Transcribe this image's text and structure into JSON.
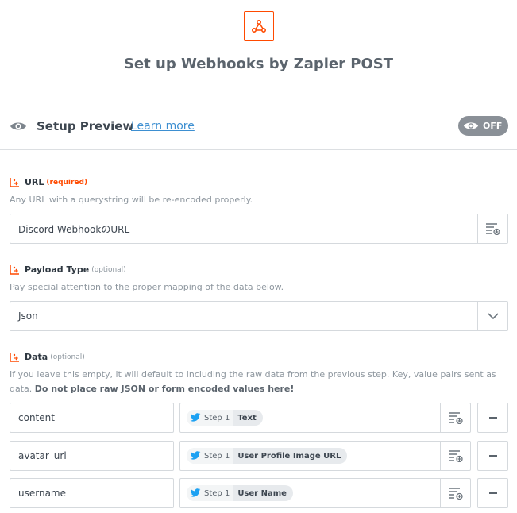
{
  "header": {
    "title": "Set up Webhooks by Zapier POST",
    "app_icon": "webhook-icon"
  },
  "preview": {
    "label": "Setup Preview",
    "learn_more": "Learn more",
    "toggle": "OFF"
  },
  "url_field": {
    "label": "URL",
    "required_tag": "(required)",
    "help": "Any URL with a querystring will be re-encoded properly.",
    "value": "Discord WebhookのURL"
  },
  "payload_field": {
    "label": "Payload Type",
    "optional_tag": "(optional)",
    "help": "Pay special attention to the proper mapping of the data below.",
    "value": "Json"
  },
  "data_field": {
    "label": "Data",
    "optional_tag": "(optional)",
    "help": "If you leave this empty, it will default to including the raw data from the previous step. Key, value pairs sent as data.",
    "help_bold": "Do not place raw JSON or form encoded values here!",
    "rows": [
      {
        "key": "content",
        "step": "Step 1",
        "field": "Text"
      },
      {
        "key": "avatar_url",
        "step": "Step 1",
        "field": "User Profile Image URL"
      },
      {
        "key": "username",
        "step": "Step 1",
        "field": "User Name"
      }
    ]
  },
  "colors": {
    "accent": "#ff4a00",
    "link": "#3d8fd1",
    "twitter": "#1da1f2",
    "toggle_bg": "#8a9097"
  }
}
